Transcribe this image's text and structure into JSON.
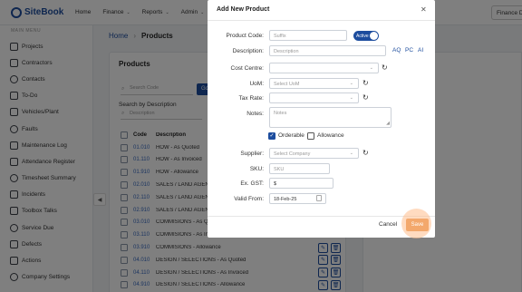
{
  "app": {
    "name": "SiteBook"
  },
  "topnav": [
    {
      "label": "Home",
      "has_menu": false
    },
    {
      "label": "Finance",
      "has_menu": true
    },
    {
      "label": "Reports",
      "has_menu": true
    },
    {
      "label": "Admin",
      "has_menu": true
    }
  ],
  "company_button": "Finance D",
  "sidebar": {
    "header": "MAIN MENU",
    "items": [
      {
        "label": "Projects",
        "icon": "folder-icon"
      },
      {
        "label": "Contractors",
        "icon": "contractors-icon"
      },
      {
        "label": "Contacts",
        "icon": "contacts-icon"
      },
      {
        "label": "To-Do",
        "icon": "todo-icon"
      },
      {
        "label": "Vehicles/Plant",
        "icon": "truck-icon"
      },
      {
        "label": "Faults",
        "icon": "warning-icon"
      },
      {
        "label": "Maintenance Log",
        "icon": "wrench-icon"
      },
      {
        "label": "Attendance Register",
        "icon": "register-icon"
      },
      {
        "label": "Timesheet Summary",
        "icon": "clock-icon"
      },
      {
        "label": "Incidents",
        "icon": "incident-icon"
      },
      {
        "label": "Toolbox Talks",
        "icon": "toolbox-icon"
      },
      {
        "label": "Service Due",
        "icon": "service-icon"
      },
      {
        "label": "Defects",
        "icon": "defects-icon"
      },
      {
        "label": "Actions",
        "icon": "actions-icon"
      },
      {
        "label": "Company Settings",
        "icon": "settings-icon"
      }
    ]
  },
  "breadcrumb": {
    "home": "Home",
    "current": "Products"
  },
  "products": {
    "title": "Products",
    "search_code_placeholder": "Search Code",
    "go_label": "Go",
    "search_desc_label": "Search by Description",
    "search_desc_placeholder": "Description",
    "columns": {
      "code": "Code",
      "description": "Description"
    },
    "rows": [
      {
        "code": "01.010",
        "description": "HOW - As Quoted"
      },
      {
        "code": "01.110",
        "description": "HOW - As Invoiced"
      },
      {
        "code": "01.910",
        "description": "HOW - Allowance"
      },
      {
        "code": "02.010",
        "description": "SALES / LAND AGEN"
      },
      {
        "code": "02.110",
        "description": "SALES / LAND AGEN"
      },
      {
        "code": "02.910",
        "description": "SALES / LAND AGEN"
      },
      {
        "code": "03.010",
        "description": "COMMISIONS - As Quot"
      },
      {
        "code": "03.110",
        "description": "COMMISIONS - As Invo"
      },
      {
        "code": "03.910",
        "description": "COMMISIONS - Allowance"
      },
      {
        "code": "04.010",
        "description": "DESIGN / SELECTIONS - As Quoted"
      },
      {
        "code": "04.110",
        "description": "DESIGN / SELECTIONS - As Invoiced"
      },
      {
        "code": "04.910",
        "description": "DESIGN / SELECTIONS - Allowance"
      }
    ]
  },
  "modal": {
    "title": "Add New Product",
    "product_code_label": "Product Code:",
    "product_code_placeholder": "Suffix",
    "active_label": "Active",
    "description_label": "Description:",
    "description_placeholder": "Description",
    "lang_aq": "AQ",
    "lang_pc": "PC",
    "lang_ai": "AI",
    "cost_centre_label": "Cost Centre:",
    "uom_label": "UoM:",
    "uom_placeholder": "Select UoM",
    "tax_rate_label": "Tax Rate:",
    "notes_label": "Notes:",
    "notes_placeholder": "Notes",
    "orderable_label": "Orderable",
    "orderable_checked": true,
    "allowance_label": "Allowance",
    "allowance_checked": false,
    "supplier_label": "Supplier:",
    "supplier_placeholder": "Select Company",
    "sku_label": "SKU:",
    "sku_placeholder": "SKU",
    "ex_gst_label": "Ex. GST:",
    "ex_gst_prefix": "$",
    "valid_from_label": "Valid From:",
    "valid_from_value": "18-Feb-25",
    "cancel_label": "Cancel",
    "save_label": "Save"
  },
  "colors": {
    "primary": "#1d4d9e",
    "save": "#f3a86c"
  }
}
